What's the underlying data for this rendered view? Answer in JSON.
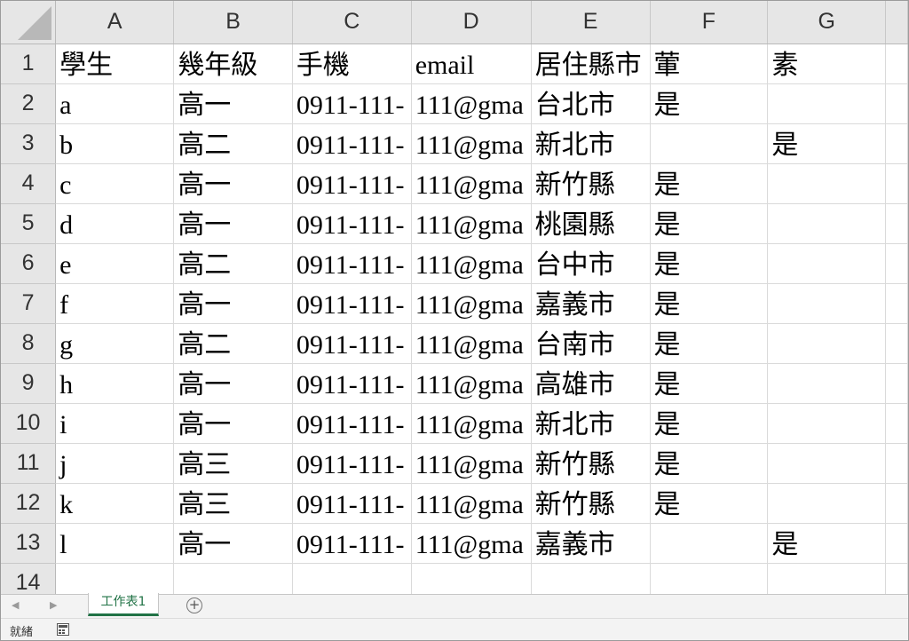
{
  "columns": [
    "A",
    "B",
    "C",
    "D",
    "E",
    "F",
    "G"
  ],
  "rows": [
    {
      "n": "1",
      "cells": [
        "學生",
        "幾年級",
        "手機",
        "email",
        "居住縣市",
        "葷",
        "素"
      ]
    },
    {
      "n": "2",
      "cells": [
        "a",
        "高一",
        "0911-111-",
        "111@gma",
        "台北市",
        "是",
        ""
      ]
    },
    {
      "n": "3",
      "cells": [
        "b",
        "高二",
        "0911-111-",
        "111@gma",
        "新北市",
        "",
        "是"
      ]
    },
    {
      "n": "4",
      "cells": [
        "c",
        "高一",
        "0911-111-",
        "111@gma",
        "新竹縣",
        "是",
        ""
      ]
    },
    {
      "n": "5",
      "cells": [
        "d",
        "高一",
        "0911-111-",
        "111@gma",
        "桃園縣",
        "是",
        ""
      ]
    },
    {
      "n": "6",
      "cells": [
        "e",
        "高二",
        "0911-111-",
        "111@gma",
        "台中市",
        "是",
        ""
      ]
    },
    {
      "n": "7",
      "cells": [
        "f",
        "高一",
        "0911-111-",
        "111@gma",
        "嘉義市",
        "是",
        ""
      ]
    },
    {
      "n": "8",
      "cells": [
        "g",
        "高二",
        "0911-111-",
        "111@gma",
        "台南市",
        "是",
        ""
      ]
    },
    {
      "n": "9",
      "cells": [
        "h",
        "高一",
        "0911-111-",
        "111@gma",
        "高雄市",
        "是",
        ""
      ]
    },
    {
      "n": "10",
      "cells": [
        "i",
        "高一",
        "0911-111-",
        "111@gma",
        "新北市",
        "是",
        ""
      ]
    },
    {
      "n": "11",
      "cells": [
        "j",
        "高三",
        "0911-111-",
        "111@gma",
        "新竹縣",
        "是",
        ""
      ]
    },
    {
      "n": "12",
      "cells": [
        "k",
        "高三",
        "0911-111-",
        "111@gma",
        "新竹縣",
        "是",
        ""
      ]
    },
    {
      "n": "13",
      "cells": [
        "l",
        "高一",
        "0911-111-",
        "111@gma",
        "嘉義市",
        "",
        "是"
      ]
    },
    {
      "n": "14",
      "cells": [
        "",
        "",
        "",
        "",
        "",
        "",
        ""
      ]
    }
  ],
  "tabs": {
    "prev_icon": "nav-prev-icon",
    "next_icon": "nav-next-icon",
    "sheet_label": "工作表1",
    "add_icon": "add-sheet-icon",
    "accent": "#217346"
  },
  "status": {
    "ready_label": "就緒",
    "icon": "macro-record-icon"
  }
}
